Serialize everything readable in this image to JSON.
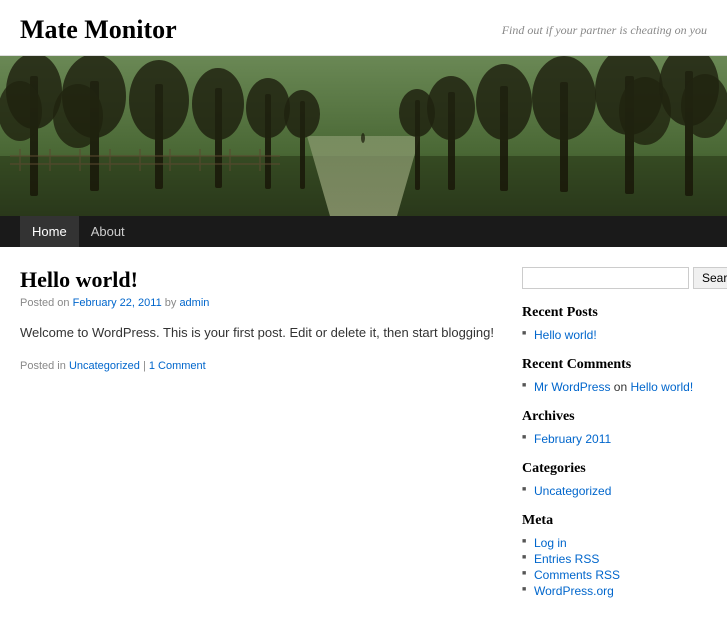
{
  "site": {
    "title": "Mate Monitor",
    "tagline": "Find out if your partner is cheating on you"
  },
  "nav": {
    "items": [
      {
        "label": "Home",
        "active": true
      },
      {
        "label": "About",
        "active": false
      }
    ]
  },
  "post": {
    "title": "Hello world!",
    "meta_prefix": "Posted on",
    "date": "February 22, 2011",
    "author_prefix": "by",
    "author": "admin",
    "content": "Welcome to WordPress. This is your first post. Edit or delete it, then start blogging!",
    "footer_prefix": "Posted in",
    "category": "Uncategorized",
    "comment_link": "1 Comment"
  },
  "sidebar": {
    "search_placeholder": "",
    "search_button": "Search",
    "recent_posts_title": "Recent Posts",
    "recent_posts": [
      {
        "label": "Hello world!"
      }
    ],
    "recent_comments_title": "Recent Comments",
    "recent_comments": [
      {
        "author": "Mr WordPress",
        "on": "on",
        "post": "Hello world!"
      }
    ],
    "archives_title": "Archives",
    "archives": [
      {
        "label": "February 2011"
      }
    ],
    "categories_title": "Categories",
    "categories": [
      {
        "label": "Uncategorized"
      }
    ],
    "meta_title": "Meta",
    "meta_links": [
      {
        "label": "Log in"
      },
      {
        "label": "Entries RSS"
      },
      {
        "label": "Comments RSS"
      },
      {
        "label": "WordPress.org"
      }
    ]
  }
}
